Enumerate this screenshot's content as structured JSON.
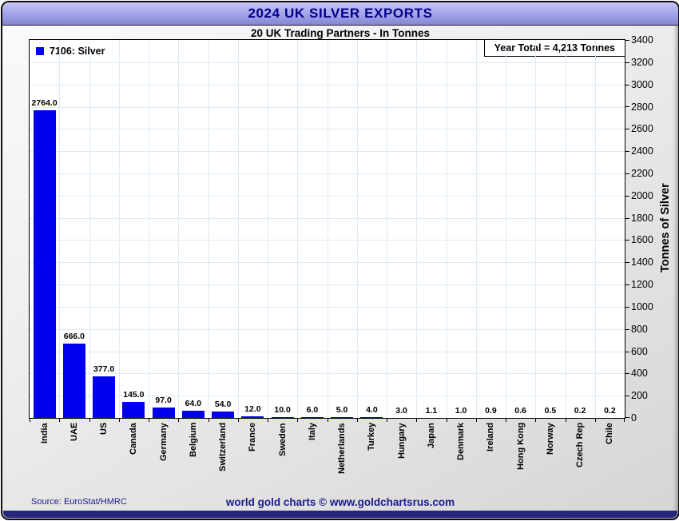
{
  "header": {
    "title": "2024 UK SILVER EXPORTS"
  },
  "subtitle": "20 UK Trading Partners - In Tonnes",
  "legend": {
    "label": "7106: Silver"
  },
  "annotation": {
    "year_total": "Year Total = 4,213 Tonnes"
  },
  "footer": {
    "source": "Source: EuroStat/HMRC",
    "credit": "world gold charts © www.goldchartsrus.com"
  },
  "colors": {
    "bar": "#0000ee",
    "title_text": "#00008b",
    "footer_text": "#1b1b8a",
    "gridline": "#dfeaf6",
    "header_bg": "#a2a2e8",
    "bottom_strip": "#26267d"
  },
  "chart_data": {
    "type": "bar",
    "title": "2024 UK SILVER EXPORTS",
    "subtitle": "20 UK Trading Partners - In Tonnes",
    "ylabel": "Tonnes of Silver",
    "ylim": [
      0,
      3400
    ],
    "ytick_step": 200,
    "grid": true,
    "legend_entries": [
      "7106: Silver"
    ],
    "legend_position": "top-left",
    "annotation": "Year Total = 4,213 Tonnes",
    "categories": [
      "India",
      "UAE",
      "US",
      "Canada",
      "Germany",
      "Belgium",
      "Switzerland",
      "France",
      "Sweden",
      "Italy",
      "Netherlands",
      "Turkey",
      "Hungary",
      "Japan",
      "Denmark",
      "Ireland",
      "Hong Kong",
      "Norway",
      "Czech Rep",
      "Chile"
    ],
    "values": [
      2764.0,
      666.0,
      377.0,
      145.0,
      97.0,
      64.0,
      54.0,
      12.0,
      10.0,
      6.0,
      5.0,
      4.0,
      3.0,
      1.1,
      1.0,
      0.9,
      0.6,
      0.5,
      0.2,
      0.2
    ],
    "value_labels": [
      "2764.0",
      "666.0",
      "377.0",
      "145.0",
      "97.0",
      "64.0",
      "54.0",
      "12.0",
      "10.0",
      "6.0",
      "5.0",
      "4.0",
      "3.0",
      "1.1",
      "1.0",
      "0.9",
      "0.6",
      "0.5",
      "0.2",
      "0.2"
    ]
  }
}
